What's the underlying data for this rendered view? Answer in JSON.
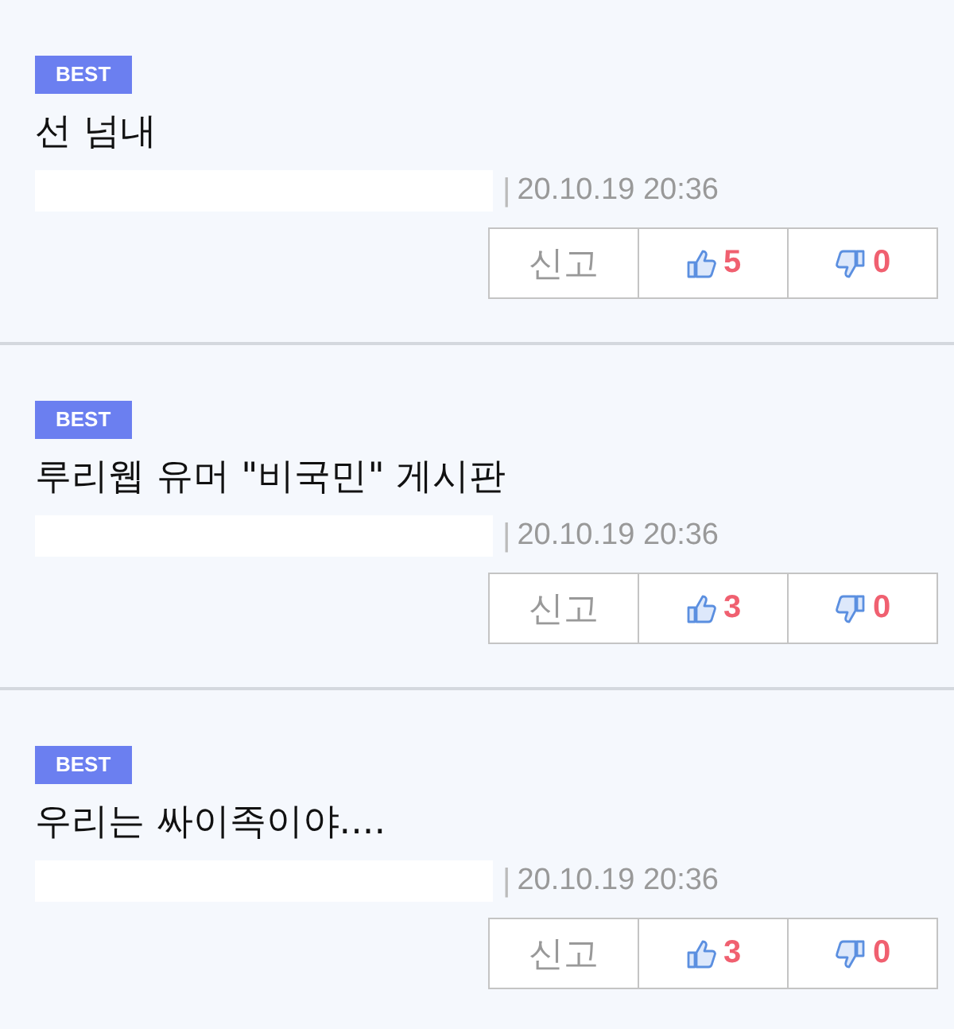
{
  "comments": [
    {
      "badge": "BEST",
      "text": "선 넘내",
      "separator": "|",
      "date": "20.10.19 20:36",
      "report": "신고",
      "likes": "5",
      "dislikes": "0"
    },
    {
      "badge": "BEST",
      "text": "루리웹 유머 \"비국민\" 게시판",
      "separator": "|",
      "date": "20.10.19 20:36",
      "report": "신고",
      "likes": "3",
      "dislikes": "0"
    },
    {
      "badge": "BEST",
      "text": "우리는 싸이족이야....",
      "separator": "|",
      "date": "20.10.19 20:36",
      "report": "신고",
      "likes": "3",
      "dislikes": "0"
    }
  ]
}
